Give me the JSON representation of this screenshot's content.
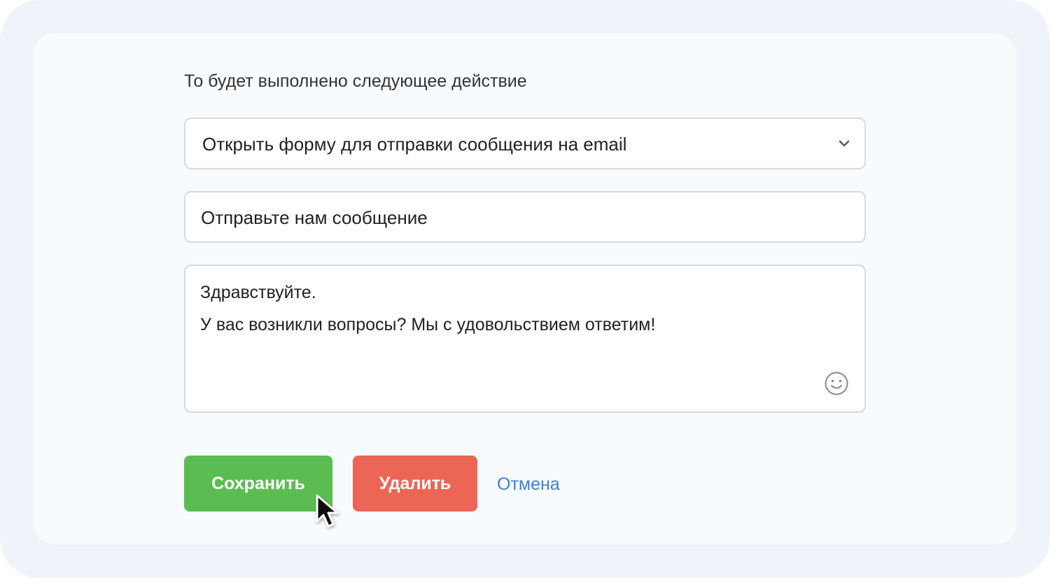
{
  "form": {
    "action_label": "То будет выполнено следующее действие",
    "action_select": {
      "selected": "Открыть форму для отправки сообщения на email"
    },
    "subject": {
      "value": "Отправьте нам сообщение"
    },
    "message": {
      "lines": [
        "Здравствуйте.",
        "У вас возникли вопросы? Мы с удовольствием ответим!"
      ]
    }
  },
  "buttons": {
    "save_label": "Сохранить",
    "delete_label": "Удалить",
    "cancel_label": "Отмена"
  },
  "icons": {
    "select": "chevron-down-icon",
    "emoji": "smiley-icon",
    "pointer": "mouse-cursor-icon"
  },
  "colors": {
    "save": "#5bbd51",
    "delete": "#ec6656",
    "link": "#3a82d8",
    "outer_background": "#eff4fa",
    "card_background": "#f8fbfe"
  }
}
